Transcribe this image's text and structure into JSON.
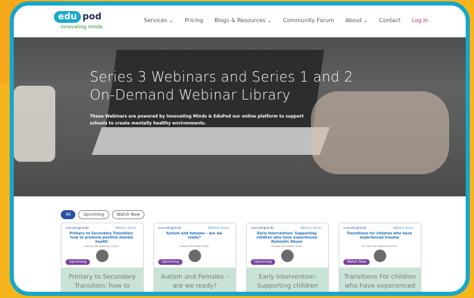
{
  "header": {
    "logo_primary": "edu",
    "logo_secondary": "pod",
    "logo_tagline": "Innovating minds",
    "nav": [
      {
        "label": "Services ⌄"
      },
      {
        "label": "Pricing"
      },
      {
        "label": "Blogs & Resources ⌄"
      },
      {
        "label": "Community Forum"
      },
      {
        "label": "About ⌄"
      },
      {
        "label": "Contact"
      },
      {
        "label": "Log In"
      }
    ]
  },
  "hero": {
    "title_line1": "Series 3 Webinars and Series 1 and 2",
    "title_line2": "On-Demand Webinar Library",
    "subtitle": "These Webinars are powered by Innovating Minds & EduPod our online platform to support schools to create mentally healthy environments."
  },
  "filters": [
    {
      "label": "All",
      "active": true
    },
    {
      "label": "Upcoming",
      "active": false
    },
    {
      "label": "Watch Now",
      "active": false
    }
  ],
  "cards": [
    {
      "logo": "innovatingminds",
      "series": "Webinar Series",
      "title": "Primary to Secondary Transition: how to promote positive mental health",
      "date": "Tuesday 14th September at 4pm",
      "badge": "Upcoming",
      "caption": "Primary to Secondary Transition: how to"
    },
    {
      "logo": "innovatingminds",
      "series": "Webinar Series",
      "title": "Autism and females – are we ready?",
      "date": "Tuesday 5th October at 4pm",
      "badge": "Upcoming",
      "caption": "Autism and Females – are we ready?"
    },
    {
      "logo": "innovatingminds",
      "series": "Webinar Series",
      "title": "Early intervention: Supporting children who have experienced Domestic Abuse",
      "date": "Thursday 21st October at 4pm",
      "badge": "Upcoming",
      "caption": "Early Intervention: Supporting children who"
    },
    {
      "logo": "innovatingminds",
      "series": "Webinar Series",
      "title": "Transitions for children who have experienced trauma",
      "date": "Thursday 16th September at 4pm",
      "badge": "Watch Now",
      "caption": "Transitions For children who have experienced"
    }
  ]
}
